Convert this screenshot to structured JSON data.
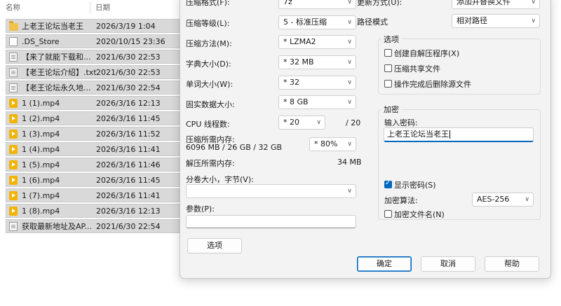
{
  "file_list": {
    "headers": {
      "name": "名称",
      "date": "日期"
    },
    "rows": [
      {
        "icon": "folder-icon",
        "name": "上老王论坛当老王",
        "date": "2026/3/19 1:04"
      },
      {
        "icon": "file-icon",
        "name": ".DS_Store",
        "date": "2020/10/15 23:36"
      },
      {
        "icon": "text-file-icon",
        "name": "【来了就能下载和...",
        "date": "2021/6/30 22:53"
      },
      {
        "icon": "text-file-icon",
        "name": "【老王论坛介绍】.txt",
        "date": "2021/6/30 22:53"
      },
      {
        "icon": "text-file-icon",
        "name": "【老王论坛永久地...",
        "date": "2021/6/30 22:54"
      },
      {
        "icon": "video-file-icon",
        "name": "1 (1).mp4",
        "date": "2026/3/16 12:13"
      },
      {
        "icon": "video-file-icon",
        "name": "1 (2).mp4",
        "date": "2026/3/16 11:45"
      },
      {
        "icon": "video-file-icon",
        "name": "1 (3).mp4",
        "date": "2026/3/16 11:52"
      },
      {
        "icon": "video-file-icon",
        "name": "1 (4).mp4",
        "date": "2026/3/16 11:41"
      },
      {
        "icon": "video-file-icon",
        "name": "1 (5).mp4",
        "date": "2026/3/16 11:46"
      },
      {
        "icon": "video-file-icon",
        "name": "1 (6).mp4",
        "date": "2026/3/16 11:45"
      },
      {
        "icon": "video-file-icon",
        "name": "1 (7).mp4",
        "date": "2026/3/16 11:41"
      },
      {
        "icon": "video-file-icon",
        "name": "1 (8).mp4",
        "date": "2026/3/16 12:13"
      },
      {
        "icon": "text-file-icon",
        "name": "获取最新地址及AP...",
        "date": "2021/6/30 22:54"
      }
    ]
  },
  "dialog": {
    "left": {
      "format_label": "压缩格式(F):",
      "format_value": "7z",
      "level_label": "压缩等级(L):",
      "level_value": "5 - 标准压缩",
      "method_label": "压缩方法(M):",
      "method_value": "* LZMA2",
      "dict_label": "字典大小(D):",
      "dict_value": "* 32 MB",
      "word_label": "单词大小(W):",
      "word_value": "* 32",
      "solid_label": "固实数据大小:",
      "solid_value": "* 8 GB",
      "threads_label": "CPU 线程数:",
      "threads_value": "* 20",
      "threads_total": "/ 20",
      "mem_compress_label": "压缩所需内存:",
      "mem_compress_detail": "6096 MB / 26 GB / 32 GB",
      "mem_percent_value": "* 80%",
      "mem_decompress_label": "解压所需内存:",
      "mem_decompress_value": "34 MB",
      "volume_label": "分卷大小，字节(V):",
      "volume_value": "",
      "params_label": "参数(P):",
      "params_value": "",
      "options_button": "选项"
    },
    "right": {
      "update_label": "更新方式(U):",
      "update_value": "添加并替换文件",
      "path_label": "路径模式",
      "path_value": "相对路径",
      "options_group": "选项",
      "opt_sfx": "创建自解压程序(X)",
      "opt_shared": "压缩共享文件",
      "opt_delete": "操作完成后删除源文件",
      "encrypt_group": "加密",
      "password_label": "输入密码:",
      "password_value": "上老王论坛当老王",
      "show_password": "显示密码(S)",
      "show_password_checked": true,
      "enc_method_label": "加密算法:",
      "enc_method_value": "AES-256",
      "encrypt_names": "加密文件名(N)"
    },
    "buttons": {
      "ok": "确定",
      "cancel": "取消",
      "help": "帮助"
    }
  }
}
